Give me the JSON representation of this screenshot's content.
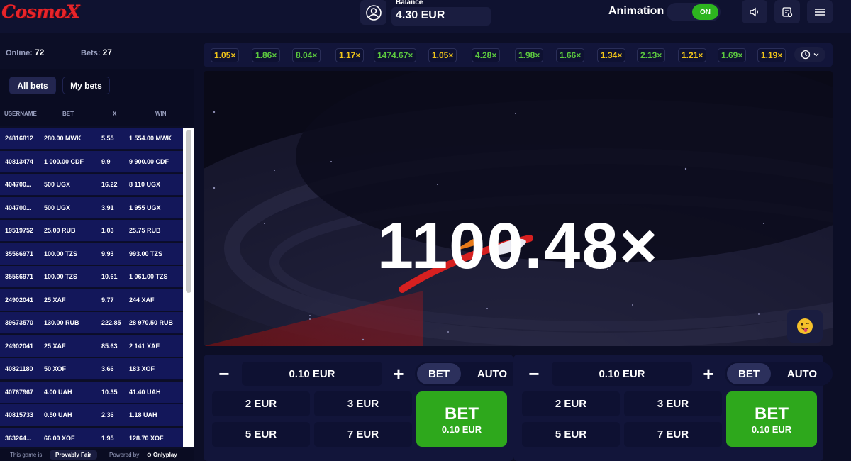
{
  "header": {
    "logo": "CosmoX",
    "balance_label": "Balance",
    "balance_value": "4.30 EUR",
    "animation_label": "Animation",
    "animation_toggle": "ON"
  },
  "stats": {
    "online_label": "Online:",
    "online": "72",
    "bets_label": "Bets:",
    "bets": "27"
  },
  "tabs": [
    "All bets",
    "My bets"
  ],
  "columns": [
    "USERNAME",
    "BET",
    "X",
    "WIN"
  ],
  "bets": [
    {
      "user": "24816812",
      "bet": "280.00 MWK",
      "x": "5.55",
      "win": "1 554.00 MWK"
    },
    {
      "user": "40813474",
      "bet": "1 000.00 CDF",
      "x": "9.9",
      "win": "9 900.00 CDF"
    },
    {
      "user": "404700...",
      "bet": "500 UGX",
      "x": "16.22",
      "win": "8 110 UGX"
    },
    {
      "user": "404700...",
      "bet": "500 UGX",
      "x": "3.91",
      "win": "1 955 UGX"
    },
    {
      "user": "19519752",
      "bet": "25.00 RUB",
      "x": "1.03",
      "win": "25.75 RUB"
    },
    {
      "user": "35566971",
      "bet": "100.00 TZS",
      "x": "9.93",
      "win": "993.00 TZS"
    },
    {
      "user": "35566971",
      "bet": "100.00 TZS",
      "x": "10.61",
      "win": "1 061.00 TZS"
    },
    {
      "user": "24902041",
      "bet": "25 XAF",
      "x": "9.77",
      "win": "244 XAF"
    },
    {
      "user": "39673570",
      "bet": "130.00 RUB",
      "x": "222.85",
      "win": "28 970.50 RUB"
    },
    {
      "user": "24902041",
      "bet": "25 XAF",
      "x": "85.63",
      "win": "2 141 XAF"
    },
    {
      "user": "40821180",
      "bet": "50 XOF",
      "x": "3.66",
      "win": "183 XOF"
    },
    {
      "user": "40767967",
      "bet": "4.00 UAH",
      "x": "10.35",
      "win": "41.40 UAH"
    },
    {
      "user": "40815733",
      "bet": "0.50 UAH",
      "x": "2.36",
      "win": "1.18 UAH"
    },
    {
      "user": "363264...",
      "bet": "66.00 XOF",
      "x": "1.95",
      "win": "128.70 XOF"
    }
  ],
  "footer": {
    "text": "This game is",
    "provably_fair": "Provably Fair",
    "powered_by": "Powered by",
    "provider": "Onlyplay"
  },
  "history": [
    {
      "v": "1.05×",
      "c": "#f0c419"
    },
    {
      "v": "1.86×",
      "c": "#5cc93f"
    },
    {
      "v": "8.04×",
      "c": "#5cc93f"
    },
    {
      "v": "1.17×",
      "c": "#f0c419"
    },
    {
      "v": "1474.67×",
      "c": "#5cc93f"
    },
    {
      "v": "1.05×",
      "c": "#f0c419"
    },
    {
      "v": "4.28×",
      "c": "#5cc93f"
    },
    {
      "v": "1.98×",
      "c": "#5cc93f"
    },
    {
      "v": "1.66×",
      "c": "#5cc93f"
    },
    {
      "v": "1.34×",
      "c": "#f0c419"
    },
    {
      "v": "2.13×",
      "c": "#5cc93f"
    },
    {
      "v": "1.21×",
      "c": "#f0c419"
    },
    {
      "v": "1.69×",
      "c": "#5cc93f"
    },
    {
      "v": "1.19×",
      "c": "#f0c419"
    }
  ],
  "game": {
    "multiplier": "1100.48×"
  },
  "bet_panels": [
    {
      "amount": "0.10 EUR",
      "mode_bet": "BET",
      "mode_auto": "AUTO",
      "quick": [
        "2 EUR",
        "3 EUR",
        "5 EUR",
        "7 EUR"
      ],
      "bet_label": "BET",
      "bet_amount": "0.10 EUR"
    },
    {
      "amount": "0.10 EUR",
      "mode_bet": "BET",
      "mode_auto": "AUTO",
      "quick": [
        "2 EUR",
        "3 EUR",
        "5 EUR",
        "7 EUR"
      ],
      "bet_label": "BET",
      "bet_amount": "0.10 EUR"
    }
  ],
  "colors": {
    "win_green": "#2ea81c",
    "low_yellow": "#f0c419",
    "high_green": "#5cc93f",
    "logo_red": "#e8242a"
  }
}
